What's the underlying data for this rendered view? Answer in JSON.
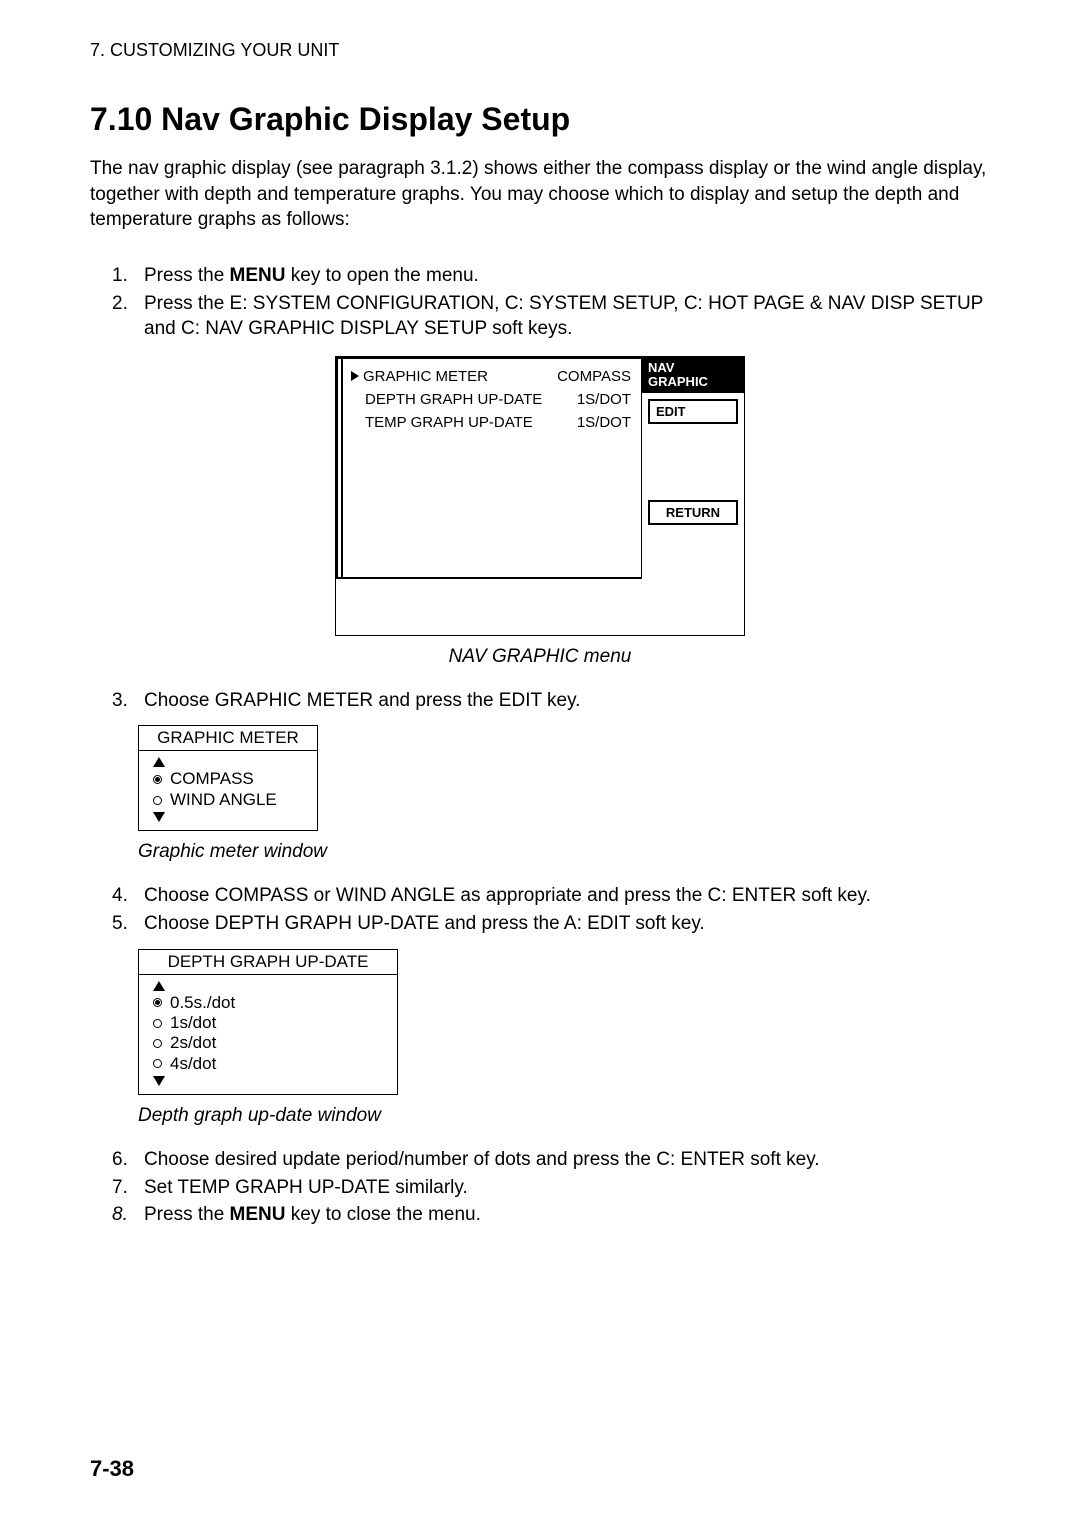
{
  "header": "7. CUSTOMIZING YOUR UNIT",
  "section_title": "7.10  Nav Graphic Display Setup",
  "intro": "The nav graphic display (see paragraph 3.1.2) shows either the compass display or the wind angle display, together with depth and temperature graphs. You may choose which to display and setup the depth and temperature graphs as follows:",
  "steps": {
    "s1_pre": "Press the ",
    "s1_bold": "MENU",
    "s1_post": " key to open the menu.",
    "s2": "Press the E: SYSTEM CONFIGURATION, C: SYSTEM SETUP, C: HOT PAGE & NAV DISP SETUP and C: NAV GRAPHIC DISPLAY SETUP soft keys.",
    "s3": "Choose GRAPHIC METER and press the EDIT key.",
    "s4": "Choose COMPASS or WIND ANGLE as appropriate and press the C: ENTER soft key.",
    "s5": "Choose DEPTH GRAPH UP-DATE and press the A: EDIT soft key.",
    "s6": "Choose desired update period/number of dots and press the C: ENTER soft key.",
    "s7": "Set TEMP GRAPH UP-DATE similarly.",
    "s8_pre": "Press the ",
    "s8_bold": "MENU",
    "s8_post": " key to close the menu."
  },
  "nums": {
    "n1": "1.",
    "n2": "2.",
    "n3": "3.",
    "n4": "4.",
    "n5": "5.",
    "n6": "6.",
    "n7": "7.",
    "n8": "8."
  },
  "nav_menu": {
    "title_l1": "NAV",
    "title_l2": "GRAPHIC",
    "rows": [
      {
        "label": "GRAPHIC METER",
        "value": "COMPASS"
      },
      {
        "label": "DEPTH GRAPH UP-DATE",
        "value": "1S/DOT"
      },
      {
        "label": "TEMP GRAPH UP-DATE",
        "value": "1S/DOT"
      }
    ],
    "softkeys": {
      "edit": "EDIT",
      "return": "RETURN"
    },
    "caption": "NAV GRAPHIC menu"
  },
  "graphic_meter_popup": {
    "title": "GRAPHIC METER",
    "options": [
      {
        "label": "COMPASS",
        "selected": true
      },
      {
        "label": "WIND ANGLE",
        "selected": false
      }
    ],
    "caption": "Graphic meter window"
  },
  "depth_popup": {
    "title": "DEPTH GRAPH UP-DATE",
    "options": [
      {
        "label": "0.5s./dot",
        "selected": true
      },
      {
        "label": "1s/dot",
        "selected": false
      },
      {
        "label": "2s/dot",
        "selected": false
      },
      {
        "label": "4s/dot",
        "selected": false
      }
    ],
    "caption": "Depth graph up-date window"
  },
  "page_number": "7-38"
}
